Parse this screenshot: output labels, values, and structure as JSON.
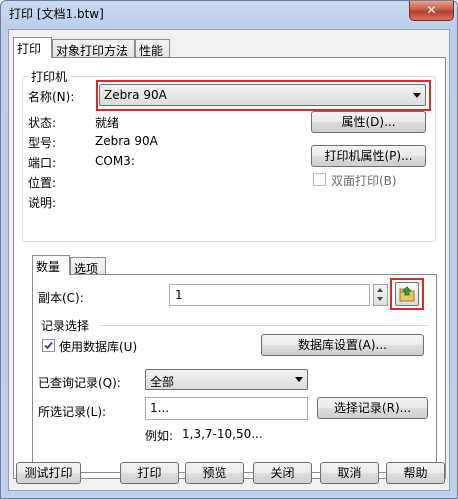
{
  "window": {
    "title": "打印 [文档1.btw]",
    "close_glyph": "✕"
  },
  "tabs": [
    "打印",
    "对象打印方法",
    "性能"
  ],
  "printer_group": {
    "title": "打印机",
    "name_label": "名称(N):",
    "name_value": "Zebra 90A",
    "properties_button": "属性(D)...",
    "printer_properties_button": "打印机属性(P)...",
    "duplex_label": "双面打印(B)",
    "rows": [
      {
        "label": "状态:",
        "value": "就绪"
      },
      {
        "label": "型号:",
        "value": "Zebra 90A"
      },
      {
        "label": "端口:",
        "value": "COM3:"
      },
      {
        "label": "位置:",
        "value": ""
      },
      {
        "label": "说明:",
        "value": ""
      }
    ]
  },
  "inner_tabs": [
    "数量",
    "选项"
  ],
  "quantity": {
    "copies_label": "副本(C):",
    "copies_value": "1",
    "record_selection_title": "记录选择",
    "use_database_label": "使用数据库(U)",
    "database_settings_button": "数据库设置(A)...",
    "queried_records_label": "已查询记录(Q):",
    "queried_records_value": "全部",
    "selected_records_label": "所选记录(L):",
    "selected_records_value": "1...",
    "select_records_button": "选择记录(R)...",
    "example_label": "例如:",
    "example_value": "1,3,7-10,50..."
  },
  "footer": {
    "test_print": "测试打印",
    "print": "打印",
    "preview": "预览",
    "close": "关闭",
    "cancel": "取消",
    "help": "帮助"
  },
  "colors": {
    "highlight_box": "#e0262b",
    "titlebar": "#c9daf0"
  }
}
